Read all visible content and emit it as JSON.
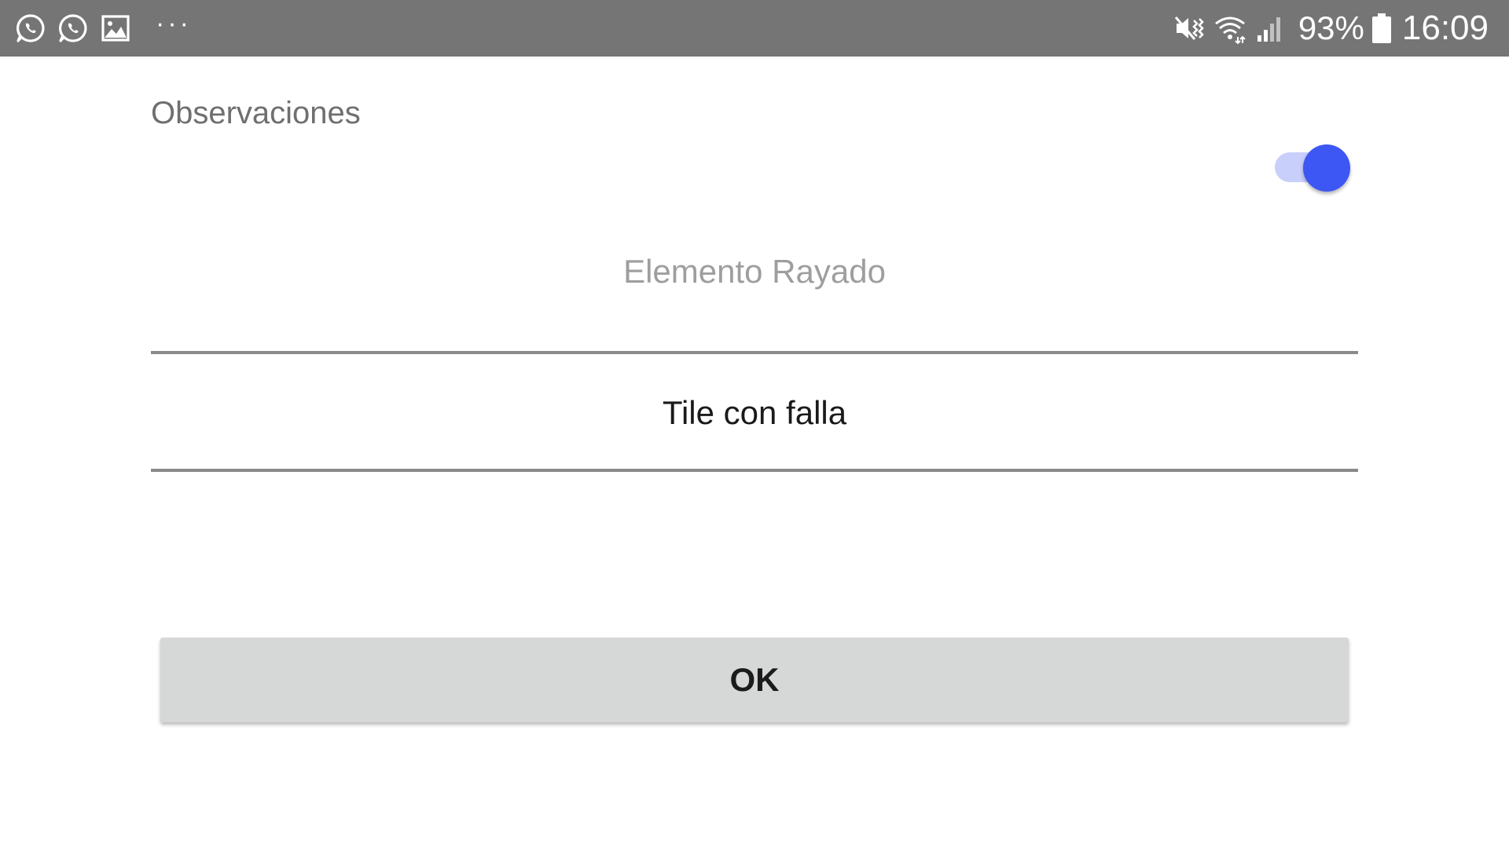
{
  "status_bar": {
    "left_icons": [
      "whatsapp-icon",
      "whatsapp-icon",
      "image-icon"
    ],
    "more_indicator": "···",
    "right_icons": [
      "mute-vibrate-icon",
      "wifi-icon",
      "signal-icon"
    ],
    "battery_percent": "93%",
    "time": "16:09",
    "background_color": "#757575"
  },
  "form": {
    "title": "Observaciones",
    "toggle": {
      "state": "on",
      "accent_color": "#3d57f4",
      "track_color": "#c9cffb"
    },
    "field_hint": "Elemento Rayado",
    "field_value": "Tile con falla"
  },
  "actions": {
    "ok_label": "OK"
  }
}
